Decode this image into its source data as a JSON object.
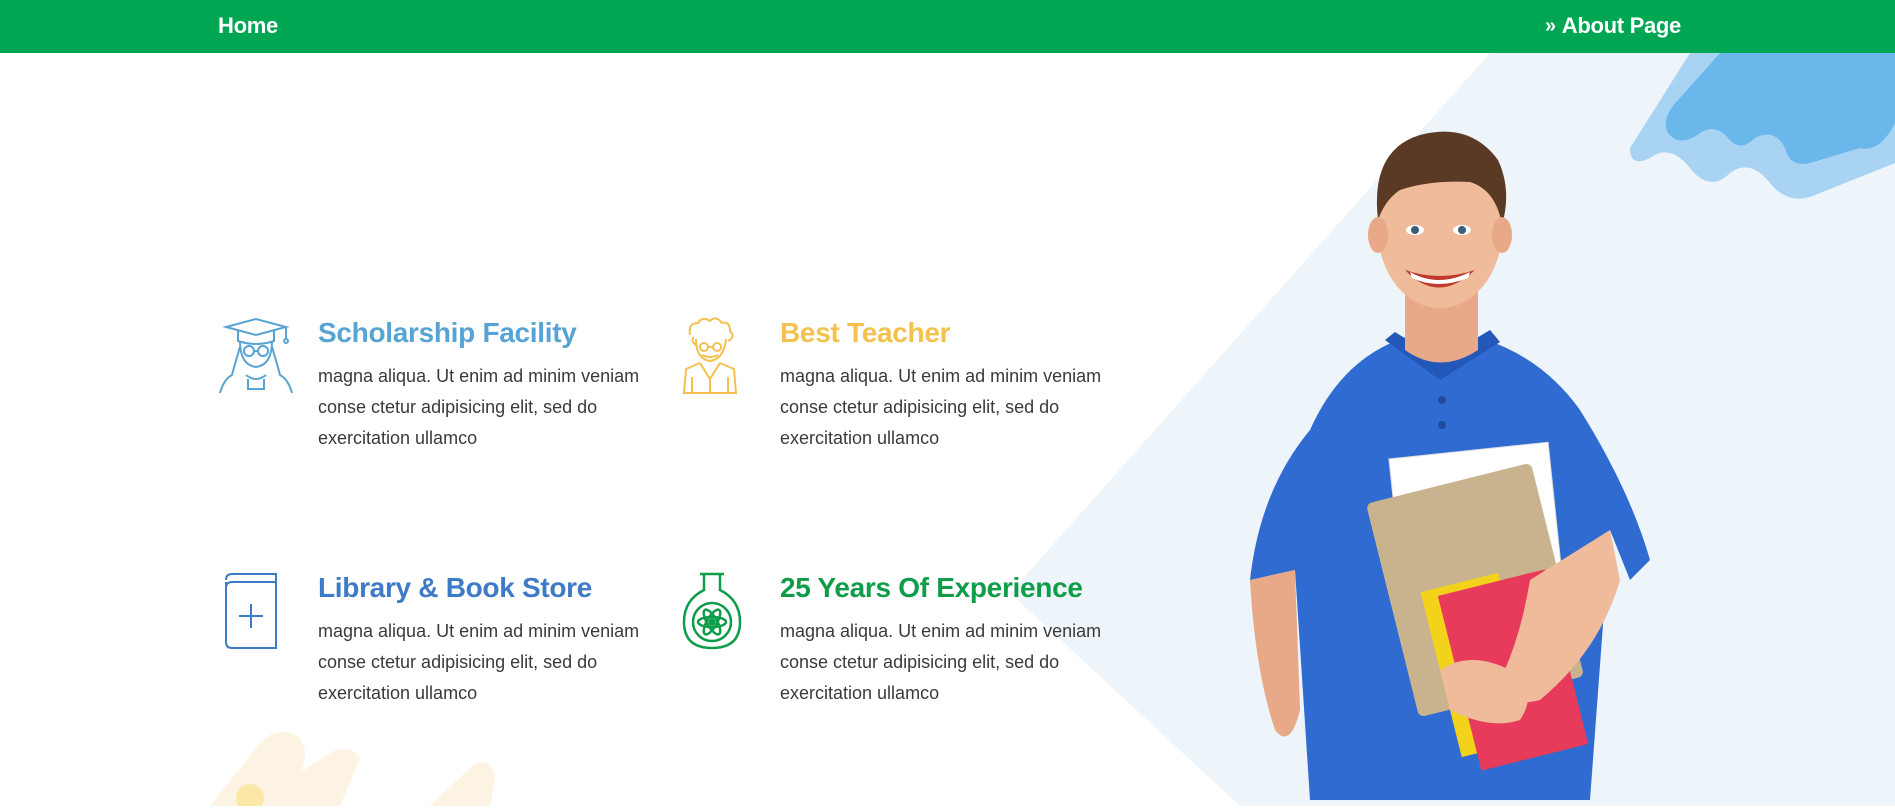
{
  "header": {
    "home_label": "Home",
    "breadcrumb_chevron": "»",
    "breadcrumb_label": "About Page"
  },
  "colors": {
    "header_bg": "#00a651",
    "scholarship": "#57a3d4",
    "teacher": "#f2c14e",
    "library": "#3e7bc6",
    "experience": "#0f9d4a",
    "blob_blue": "#6ab7ec",
    "blob_light": "#eef5fa"
  },
  "features": [
    {
      "title": "Scholarship Facility",
      "desc": "magna aliqua. Ut enim ad minim veniam conse ctetur adipisicing elit, sed do exercitation ullamco",
      "icon": "graduate-icon"
    },
    {
      "title": "Best Teacher",
      "desc": "magna aliqua. Ut enim ad minim veniam conse ctetur adipisicing elit, sed do exercitation ullamco",
      "icon": "professor-icon"
    },
    {
      "title": "Library & Book Store",
      "desc": "magna aliqua. Ut enim ad minim veniam conse ctetur adipisicing elit, sed do exercitation ullamco",
      "icon": "book-icon"
    },
    {
      "title": "25 Years Of Experience",
      "desc": "magna aliqua. Ut enim ad minim veniam conse ctetur adipisicing elit, sed do exercitation ullamco",
      "icon": "flask-atom-icon"
    }
  ]
}
